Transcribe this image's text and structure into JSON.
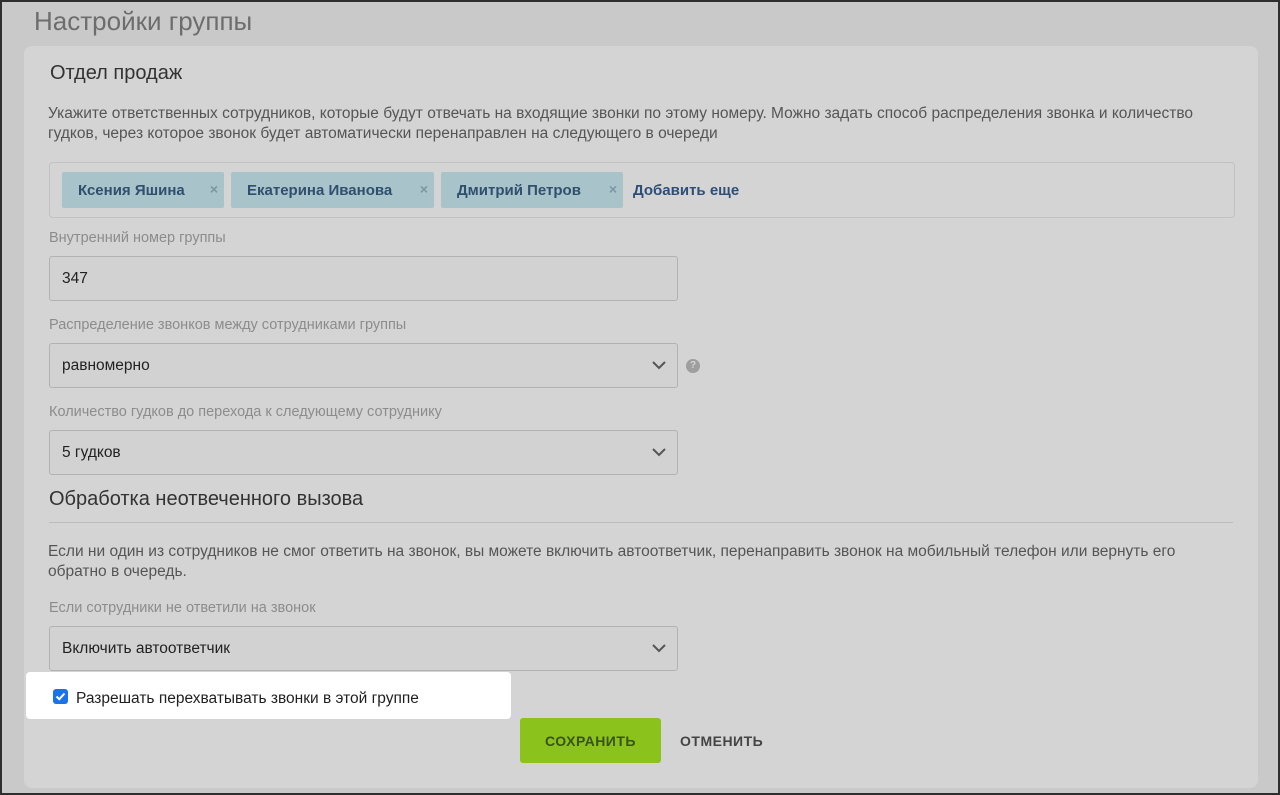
{
  "page": {
    "title": "Настройки группы"
  },
  "group": {
    "name": "Отдел продаж",
    "description": "Укажите ответственных сотрудников, которые будут отвечать на входящие звонки по этому номеру. Можно задать способ распределения звонка и количество гудков, через которое звонок будет автоматически перенаправлен на следующего в очереди",
    "employees": [
      "Ксения Яшина",
      "Екатерина Иванова",
      "Дмитрий Петров"
    ],
    "add_more_label": "Добавить еще",
    "remove_glyph": "×"
  },
  "fields": {
    "internal_number_label": "Внутренний номер группы",
    "internal_number_value": "347",
    "distribution_label": "Распределение звонков между сотрудниками группы",
    "distribution_value": "равномерно",
    "help_glyph": "?",
    "rings_label": "Количество гудков до перехода к следующему сотруднику",
    "rings_value": "5 гудков"
  },
  "unanswered": {
    "title": "Обработка неотвеченного вызова",
    "description": "Если ни один из сотрудников не смог ответить на звонок, вы можете включить автоответчик, перенаправить звонок на мобильный телефон или вернуть его обратно в очередь.",
    "action_label": "Если сотрудники не ответили на звонок",
    "action_value": "Включить автоответчик"
  },
  "intercept": {
    "label": "Разрешать перехватывать звонки в этой группе",
    "checked": true
  },
  "actions": {
    "save_label": "СОХРАНИТЬ",
    "cancel_label": "ОТМЕНИТЬ"
  },
  "colors": {
    "accent_green": "#8cc21c",
    "tag_bg": "#a9c3cb",
    "checkbox_blue": "#1a73e8"
  }
}
